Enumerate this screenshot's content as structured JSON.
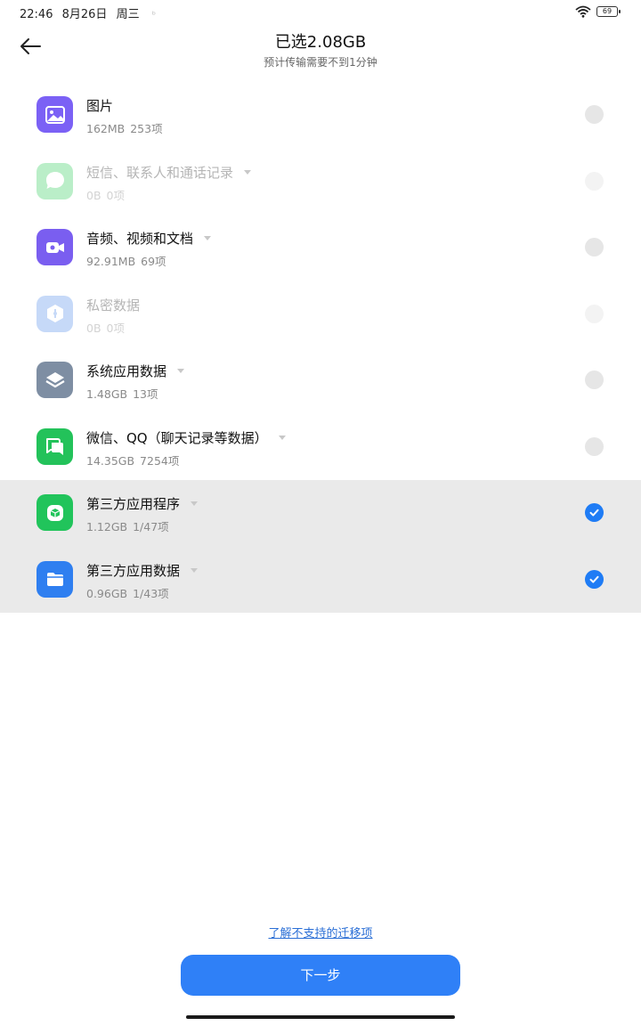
{
  "status_bar": {
    "time": "22:46",
    "date": "8月26日",
    "weekday": "周三",
    "battery": "69"
  },
  "header": {
    "title": "已选2.08GB",
    "subtitle": "预计传输需要不到1分钟"
  },
  "colors": {
    "accent": "#2f80f7",
    "selected_row": "#eaeaea",
    "check": "#1f7cf5"
  },
  "items": [
    {
      "name": "图片",
      "size": "162MB",
      "count": "253项",
      "icon": "image-icon",
      "color": "#7b61f5",
      "state": "unchecked",
      "caret": false
    },
    {
      "name": "短信、联系人和通话记录",
      "size": "0B",
      "count": "0项",
      "icon": "message-icon",
      "color": "#3ccf63",
      "state": "disabled",
      "caret": true
    },
    {
      "name": "音频、视频和文档",
      "size": "92.91MB",
      "count": "69项",
      "icon": "video-icon",
      "color": "#7a5ef0",
      "state": "unchecked",
      "caret": true
    },
    {
      "name": "私密数据",
      "size": "0B",
      "count": "0项",
      "icon": "private-icon",
      "color": "#5d95ec",
      "state": "disabled",
      "caret": false
    },
    {
      "name": "系统应用数据",
      "size": "1.48GB",
      "count": "13项",
      "icon": "layers-icon",
      "color": "#7e8ea3",
      "state": "unchecked",
      "caret": true
    },
    {
      "name": "微信、QQ（聊天记录等数据）",
      "size": "14.35GB",
      "count": "7254项",
      "icon": "chat-icon",
      "color": "#23c25a",
      "state": "unchecked",
      "caret": true
    },
    {
      "name": "第三方应用程序",
      "size": "1.12GB",
      "count": "1/47项",
      "icon": "app-cube-icon",
      "color": "#21c45b",
      "state": "checked",
      "caret": true
    },
    {
      "name": "第三方应用数据",
      "size": "0.96GB",
      "count": "1/43项",
      "icon": "folder-icon",
      "color": "#2f7ff0",
      "state": "checked",
      "caret": true
    }
  ],
  "footer": {
    "link": "了解不支持的迁移项",
    "next": "下一步"
  }
}
